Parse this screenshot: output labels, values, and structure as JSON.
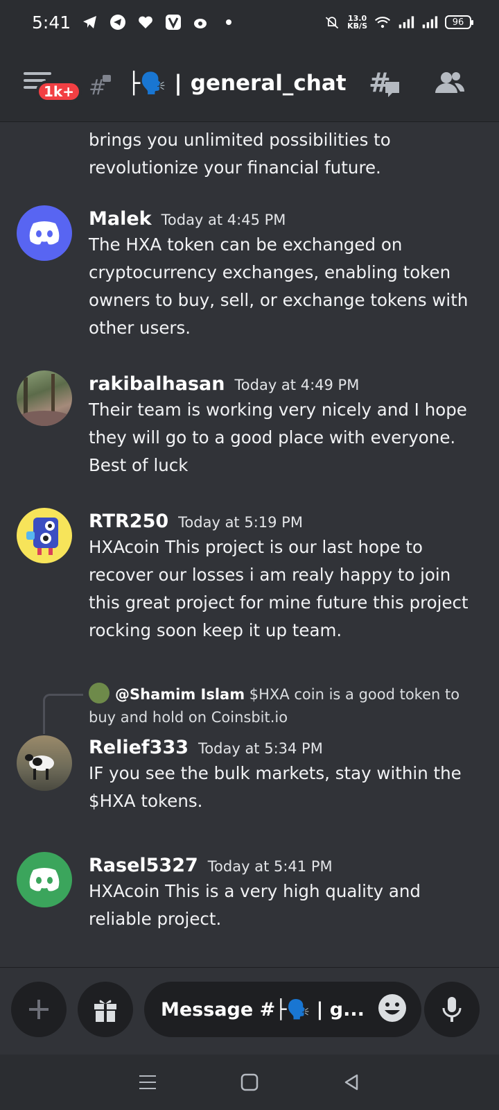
{
  "status_bar": {
    "time": "5:41",
    "net_speed_value": "13.0",
    "net_speed_unit": "KB/S",
    "battery": "96"
  },
  "header": {
    "badge": "1k+",
    "channel_name": "general_chat",
    "channel_separator": "|"
  },
  "messages": [
    {
      "author": "",
      "timestamp": "",
      "text": "brings you unlimited possibilities to revolutionize your financial future."
    },
    {
      "author": "Malek",
      "timestamp": "Today at 4:45 PM",
      "text": "The HXA token can be exchanged on cryptocurrency exchanges, enabling token owners to buy, sell, or exchange tokens with other users."
    },
    {
      "author": "rakibalhasan",
      "timestamp": "Today at 4:49 PM",
      "text": "Their team is working very nicely and I hope they will go to a good place with everyone. Best of luck"
    },
    {
      "author": "RTR250",
      "timestamp": "Today at 5:19 PM",
      "text": "HXAcoin This project is our last hope to recover our losses i am realy happy to join this great project for mine future this project rocking soon keep it up team."
    },
    {
      "reply_to": "@Shamim Islam",
      "reply_text": "$HXA coin is a good token to buy and hold on Coinsbit.io",
      "author": "Relief333",
      "timestamp": "Today at 5:34 PM",
      "text": "IF you see the bulk markets, stay within the $HXA tokens."
    },
    {
      "author": "Rasel5327",
      "timestamp": "Today at 5:41 PM",
      "text": "HXAcoin This is a very high quality and reliable project."
    }
  ],
  "composer": {
    "placeholder": "Message #├🗣️ | g..."
  },
  "colors": {
    "background": "#313338",
    "header_bg": "#2b2d31",
    "discord_blurple": "#5865f2",
    "discord_green": "#3ba55c",
    "badge_red": "#f23f43"
  }
}
